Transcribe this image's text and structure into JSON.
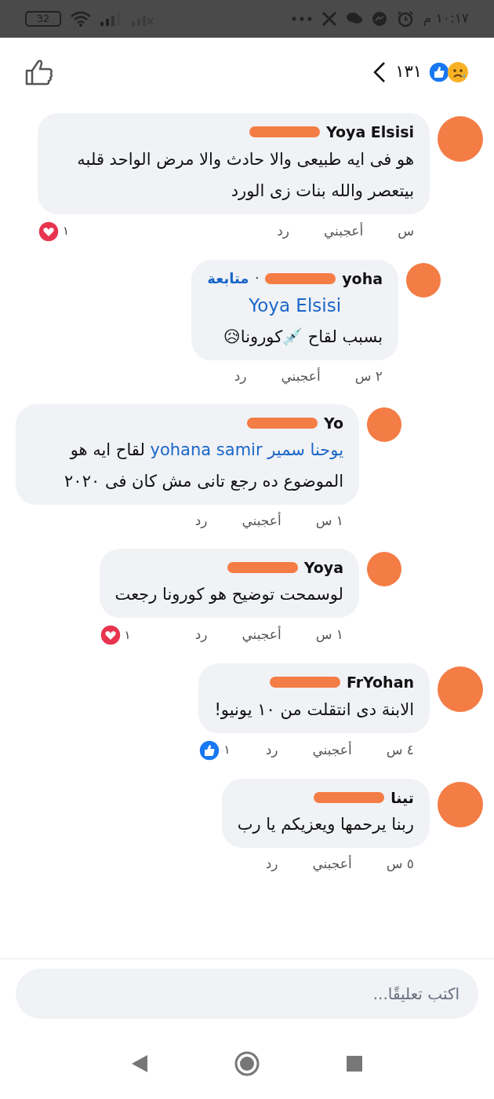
{
  "status_bar": {
    "time": "١٠:١٧ م",
    "battery": "32"
  },
  "header": {
    "reaction_count": "١٣١"
  },
  "comments": [
    {
      "name": "Yoya Elsisi",
      "redacted": true,
      "body": [
        {
          "text": "هو فى ايه طبيعى والا حادث والا مرض الواحد قلبه بيتعصر والله بنات زى الورد",
          "mention": false
        }
      ],
      "time": "س",
      "like": "أعجبني",
      "reply": "رد",
      "reaction": {
        "kind": "love",
        "count": "١"
      },
      "children": [
        {
          "name": "yoha",
          "redacted": true,
          "follow_separator": "·",
          "follow": "متابعة",
          "mention_line": "Yoya Elsisi",
          "body": [
            {
              "text": "بسبب لقاح 💉كورونا😥",
              "mention": false
            }
          ],
          "time": "٢ س",
          "like": "أعجبني",
          "reply": "رد",
          "children": [
            {
              "name": "Yo",
              "redacted": true,
              "body": [
                {
                  "text": "يوحنا سمير yohana samir",
                  "mention": true
                },
                {
                  "text": " لقاح ايه هو الموضوع ده رجع تانى مش كان فى ٢٠٢٠",
                  "mention": false
                }
              ],
              "time": "١ س",
              "like": "أعجبني",
              "reply": "رد"
            },
            {
              "name": "Yoya",
              "redacted": true,
              "body": [
                {
                  "text": "لوسمحت توضيح هو كورونا رجعت",
                  "mention": false
                }
              ],
              "time": "١ س",
              "like": "أعجبني",
              "reply": "رد",
              "reaction": {
                "kind": "love",
                "count": "١"
              }
            }
          ]
        }
      ]
    },
    {
      "name": "FrYohan",
      "redacted": true,
      "body": [
        {
          "text": "الابنة دى انتقلت من ١٠ يونيو!",
          "mention": false
        }
      ],
      "time": "٤ س",
      "like": "أعجبني",
      "reply": "رد",
      "reaction": {
        "kind": "like",
        "count": "١"
      }
    },
    {
      "name": "تينا",
      "redacted": true,
      "body": [
        {
          "text": "ربنا يرحمها ويعزيكم يا رب",
          "mention": false
        }
      ],
      "time": "٥ س",
      "like": "أعجبني",
      "reply": "رد"
    }
  ],
  "composer": {
    "placeholder": "اكتب تعليقًا..."
  }
}
